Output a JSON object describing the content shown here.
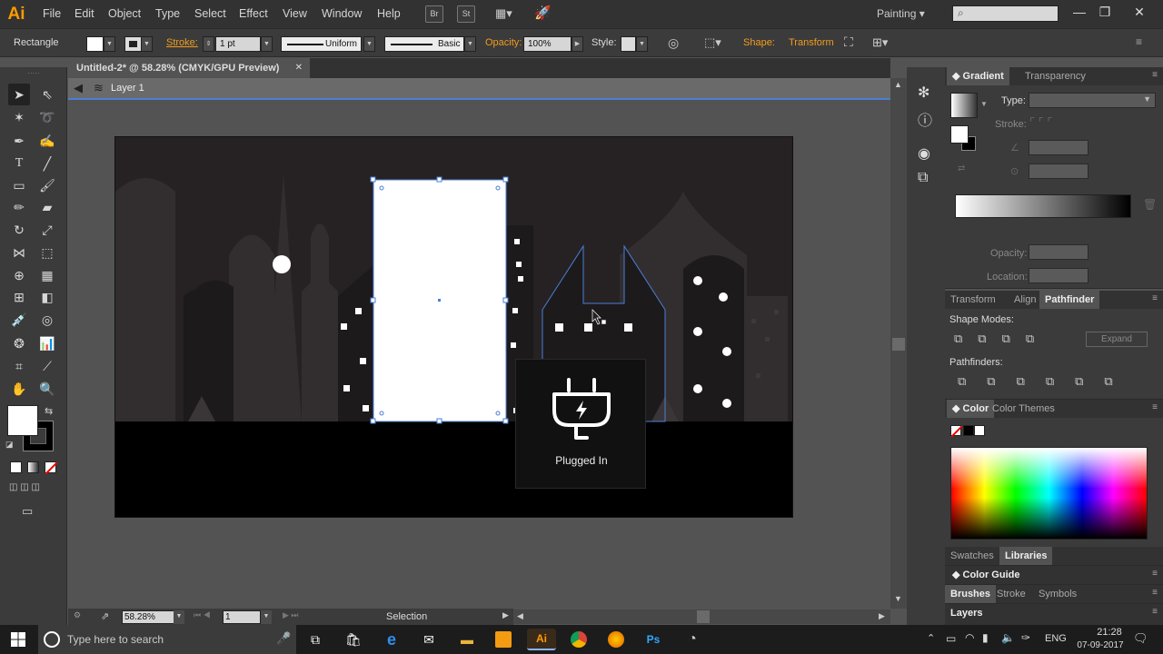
{
  "app": {
    "logo": "Ai",
    "menus": [
      "File",
      "Edit",
      "Object",
      "Type",
      "Select",
      "Effect",
      "View",
      "Window",
      "Help"
    ],
    "bridge_btn": "Br",
    "stock_btn": "St",
    "workspace": "Painting",
    "window_controls": [
      "—",
      "❐",
      "✕"
    ]
  },
  "control_bar": {
    "object_type": "Rectangle",
    "stroke_label": "Stroke:",
    "stroke_weight": "1 pt",
    "profile": "Uniform",
    "brush": "Basic",
    "opacity_label": "Opacity:",
    "opacity_value": "100%",
    "style_label": "Style:",
    "shape_label": "Shape:",
    "transform_label": "Transform"
  },
  "document": {
    "tab_title": "Untitled-2* @ 58.28% (CMYK/GPU Preview)",
    "tab_close": "✕",
    "layer": "Layer 1"
  },
  "artwork": {
    "tooltip_title": "Plugged In"
  },
  "status": {
    "zoom": "58.28%",
    "artboard_num": "1",
    "tool": "Selection"
  },
  "panels": {
    "gradient": {
      "tabs": [
        "Gradient",
        "Transparency"
      ],
      "type_label": "Type:",
      "stroke_label": "Stroke:",
      "opacity_label": "Opacity:",
      "location_label": "Location:"
    },
    "pathfinder": {
      "tabs": [
        "Transform",
        "Align",
        "Pathfinder"
      ],
      "shape_modes": "Shape Modes:",
      "expand": "Expand",
      "pathfinders": "Pathfinders:"
    },
    "color": {
      "tabs": [
        "Color",
        "Color Themes"
      ]
    },
    "swatches": {
      "tabs": [
        "Swatches",
        "Libraries"
      ]
    },
    "color_guide": "Color Guide",
    "brushes": {
      "tabs": [
        "Brushes",
        "Stroke",
        "Symbols"
      ]
    },
    "layers": "Layers"
  },
  "taskbar": {
    "search_placeholder": "Type here to search",
    "lang": "ENG",
    "time": "21:28",
    "date": "07-09-2017"
  },
  "colors": {
    "accent_orange": "#f29c1f",
    "selection_blue": "#4a7fd6",
    "ai_orange": "#ff9a00",
    "artboard_bg": "#262224"
  }
}
